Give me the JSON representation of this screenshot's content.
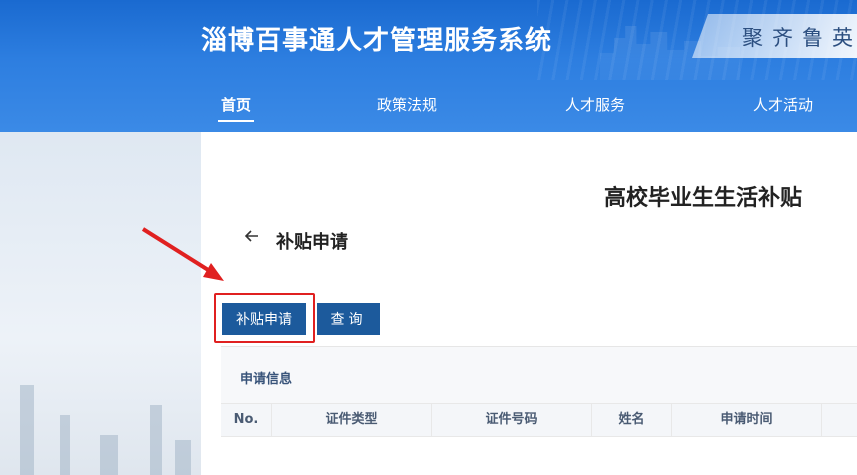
{
  "header": {
    "site_title": "淄博百事通人才管理服务系统",
    "slogan": "聚齐鲁英才"
  },
  "nav": {
    "items": [
      {
        "label": "首页",
        "active": true
      },
      {
        "label": "政策法规",
        "active": false
      },
      {
        "label": "人才服务",
        "active": false
      },
      {
        "label": "人才活动",
        "active": false
      }
    ]
  },
  "main": {
    "page_title": "高校毕业生生活补贴",
    "back_icon": "arrow-left-icon",
    "section_heading": "补贴申请",
    "buttons": {
      "apply_label": "补贴申请",
      "query_label": "查询"
    },
    "card": {
      "title": "申请信息",
      "columns": [
        "No.",
        "证件类型",
        "证件号码",
        "姓名",
        "申请时间"
      ]
    }
  },
  "colors": {
    "header_blue": "#1a6ad0",
    "button_blue": "#1c5a9c",
    "highlight_red": "#e02020"
  }
}
